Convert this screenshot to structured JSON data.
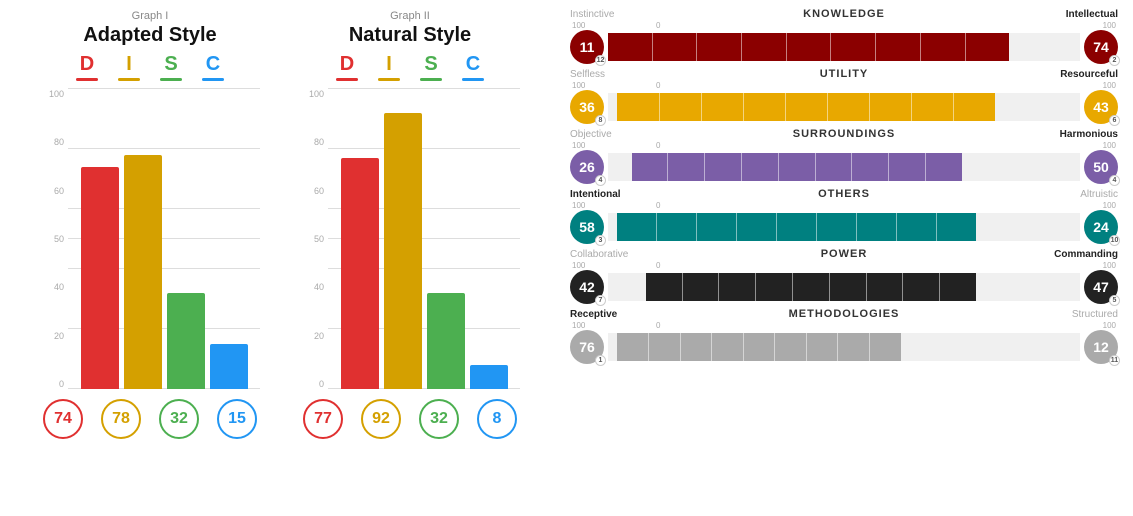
{
  "graphs": [
    {
      "label": "Graph I",
      "title": "Adapted Style",
      "letters": [
        {
          "char": "D",
          "color": "#e03030",
          "underlineColor": "#e03030"
        },
        {
          "char": "I",
          "color": "#d4a000",
          "underlineColor": "#d4a000"
        },
        {
          "char": "S",
          "color": "#4caf50",
          "underlineColor": "#4caf50"
        },
        {
          "char": "C",
          "color": "#2196f3",
          "underlineColor": "#2196f3"
        }
      ],
      "bars": [
        {
          "value": 74,
          "color": "#e03030"
        },
        {
          "value": 78,
          "color": "#d4a000"
        },
        {
          "value": 32,
          "color": "#4caf50"
        },
        {
          "value": 15,
          "color": "#2196f3"
        }
      ],
      "scores": [
        74,
        78,
        32,
        15
      ],
      "scoreColors": [
        "#e03030",
        "#d4a000",
        "#4caf50",
        "#2196f3"
      ]
    },
    {
      "label": "Graph II",
      "title": "Natural Style",
      "letters": [
        {
          "char": "D",
          "color": "#e03030",
          "underlineColor": "#e03030"
        },
        {
          "char": "I",
          "color": "#d4a000",
          "underlineColor": "#d4a000"
        },
        {
          "char": "S",
          "color": "#4caf50",
          "underlineColor": "#4caf50"
        },
        {
          "char": "C",
          "color": "#2196f3",
          "underlineColor": "#2196f3"
        }
      ],
      "bars": [
        {
          "value": 77,
          "color": "#e03030"
        },
        {
          "value": 92,
          "color": "#d4a000"
        },
        {
          "value": 32,
          "color": "#4caf50"
        },
        {
          "value": 8,
          "color": "#2196f3"
        }
      ],
      "scores": [
        77,
        92,
        32,
        8
      ],
      "scoreColors": [
        "#e03030",
        "#d4a000",
        "#4caf50",
        "#2196f3"
      ]
    }
  ],
  "metrics": [
    {
      "center": "KNOWLEDGE",
      "leftLabel": "Instinctive",
      "rightLabel": "Intellectual",
      "leftBold": false,
      "rightBold": true,
      "leftScore": 11,
      "rightScore": 74,
      "leftSub": 12,
      "rightSub": 2,
      "leftCircleColor": "#8b0000",
      "rightCircleColor": "#8b0000",
      "barColor": "#8b0000",
      "fillFrom": 0,
      "fillTo": 85,
      "scaleLeft": "100",
      "scaleCenter": "0",
      "scaleRight": "100"
    },
    {
      "center": "UTILITY",
      "leftLabel": "Selfless",
      "rightLabel": "Resourceful",
      "leftBold": false,
      "rightBold": true,
      "leftScore": 36,
      "rightScore": 43,
      "leftSub": 8,
      "rightSub": 6,
      "leftCircleColor": "#e8a800",
      "rightCircleColor": "#e8a800",
      "barColor": "#e8a800",
      "fillFrom": 2,
      "fillTo": 82,
      "scaleLeft": "100",
      "scaleCenter": "0",
      "scaleRight": "100"
    },
    {
      "center": "SURROUNDINGS",
      "leftLabel": "Objective",
      "rightLabel": "Harmonious",
      "leftBold": false,
      "rightBold": true,
      "leftScore": 26,
      "rightScore": 50,
      "leftSub": 4,
      "rightSub": 4,
      "leftCircleColor": "#7b5ea7",
      "rightCircleColor": "#7b5ea7",
      "barColor": "#7b5ea7",
      "fillFrom": 5,
      "fillTo": 75,
      "scaleLeft": "100",
      "scaleCenter": "0",
      "scaleRight": "100"
    },
    {
      "center": "OTHERS",
      "leftLabel": "Intentional",
      "rightLabel": "Altruistic",
      "leftBold": true,
      "rightBold": false,
      "leftScore": 58,
      "rightScore": 24,
      "leftSub": 3,
      "rightSub": 10,
      "leftCircleColor": "#008080",
      "rightCircleColor": "#008080",
      "barColor": "#008080",
      "fillFrom": 2,
      "fillTo": 78,
      "scaleLeft": "100",
      "scaleCenter": "0",
      "scaleRight": "100"
    },
    {
      "center": "POWER",
      "leftLabel": "Collaborative",
      "rightLabel": "Commanding",
      "leftBold": false,
      "rightBold": true,
      "leftScore": 42,
      "rightScore": 47,
      "leftSub": 7,
      "rightSub": 5,
      "leftCircleColor": "#222222",
      "rightCircleColor": "#222222",
      "barColor": "#222222",
      "fillFrom": 8,
      "fillTo": 78,
      "scaleLeft": "100",
      "scaleCenter": "0",
      "scaleRight": "100"
    },
    {
      "center": "METHODOLOGIES",
      "leftLabel": "Receptive",
      "rightLabel": "Structured",
      "leftBold": true,
      "rightBold": false,
      "leftScore": 76,
      "rightScore": 12,
      "leftSub": 1,
      "rightSub": 11,
      "leftCircleColor": "#aaaaaa",
      "rightCircleColor": "#aaaaaa",
      "barColor": "#aaaaaa",
      "fillFrom": 2,
      "fillTo": 62,
      "scaleLeft": "100",
      "scaleCenter": "0",
      "scaleRight": "100"
    }
  ],
  "yLabels": [
    "100",
    "80",
    "60",
    "50",
    "40",
    "20",
    "0"
  ]
}
